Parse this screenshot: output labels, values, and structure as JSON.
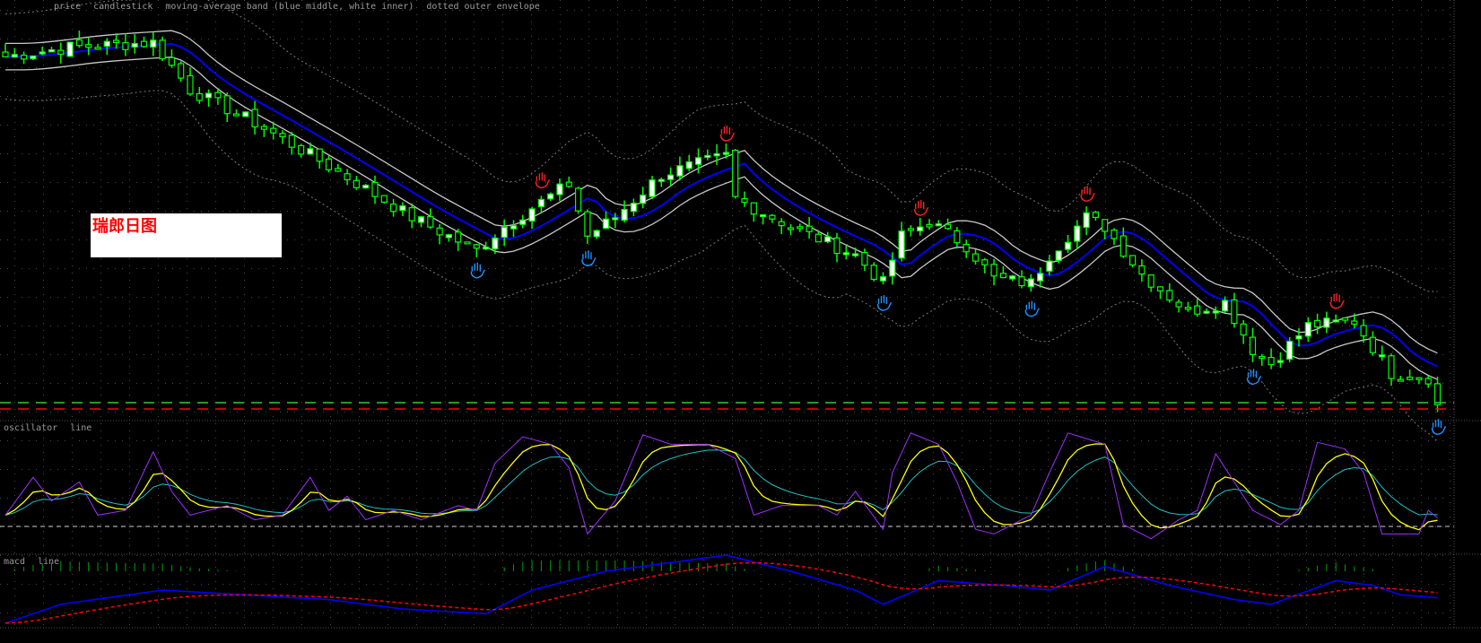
{
  "label": {
    "text": "瑞郎日图"
  },
  "colors": {
    "background": "#000000",
    "grid": "#5a5a5a",
    "candle": "#00ff00",
    "bull_body": "#ffffff",
    "band_mid": "#0000ff",
    "band_inner": "#c8c8c8",
    "band_outer": "#7a7a7a",
    "osc_fast": "#9b30ff",
    "osc_mid": "#ffff00",
    "osc_slow": "#20c0c0",
    "macd": "#0000ff",
    "signal": "#ff0000",
    "hist": "#00a000",
    "top_marker": "#ff2020",
    "bottom_marker": "#2090ff",
    "level_green": "#33cc33",
    "level_red": "#ff0000"
  },
  "chart_data": [
    {
      "type": "candlestick",
      "pane": "price",
      "bars": 156,
      "close_anchors": [
        [
          0,
          0.94
        ],
        [
          7,
          0.95
        ],
        [
          16,
          0.955
        ],
        [
          20,
          0.905
        ],
        [
          27,
          0.87
        ],
        [
          34,
          0.83
        ],
        [
          39,
          0.8
        ],
        [
          44,
          0.77
        ],
        [
          51,
          0.735
        ],
        [
          54,
          0.76
        ],
        [
          57,
          0.78
        ],
        [
          61,
          0.805
        ],
        [
          63,
          0.75
        ],
        [
          66,
          0.77
        ],
        [
          71,
          0.815
        ],
        [
          78,
          0.835
        ],
        [
          79,
          0.79
        ],
        [
          85,
          0.76
        ],
        [
          92,
          0.73
        ],
        [
          95,
          0.7
        ],
        [
          97,
          0.75
        ],
        [
          100,
          0.765
        ],
        [
          104,
          0.74
        ],
        [
          107,
          0.705
        ],
        [
          111,
          0.7
        ],
        [
          113,
          0.73
        ],
        [
          117,
          0.77
        ],
        [
          119,
          0.76
        ],
        [
          123,
          0.71
        ],
        [
          128,
          0.67
        ],
        [
          132,
          0.68
        ],
        [
          135,
          0.63
        ],
        [
          137,
          0.615
        ],
        [
          141,
          0.655
        ],
        [
          146,
          0.66
        ],
        [
          150,
          0.605
        ],
        [
          154,
          0.6
        ],
        [
          155,
          0.57
        ]
      ],
      "overlays": [
        "moving-average band (blue middle, white inner)",
        "dotted outer envelope"
      ],
      "levels": [
        0.573,
        0.567
      ],
      "markers": {
        "top": [
          58,
          78,
          99,
          117,
          144
        ],
        "bottom": [
          51,
          63,
          95,
          111,
          135,
          155
        ]
      }
    },
    {
      "type": "line",
      "pane": "oscillator",
      "fast_anchors": [
        [
          0,
          12
        ],
        [
          3,
          52
        ],
        [
          5,
          27
        ],
        [
          8,
          47
        ],
        [
          10,
          12
        ],
        [
          13,
          17
        ],
        [
          16,
          79
        ],
        [
          18,
          37
        ],
        [
          20,
          12
        ],
        [
          24,
          22
        ],
        [
          27,
          7
        ],
        [
          30,
          12
        ],
        [
          33,
          52
        ],
        [
          35,
          17
        ],
        [
          37,
          32
        ],
        [
          39,
          7
        ],
        [
          42,
          17
        ],
        [
          45,
          7
        ],
        [
          49,
          22
        ],
        [
          51,
          17
        ],
        [
          53,
          67
        ],
        [
          56,
          95
        ],
        [
          59,
          87
        ],
        [
          61,
          62
        ],
        [
          63,
          -8
        ],
        [
          66,
          27
        ],
        [
          69,
          97
        ],
        [
          72,
          87
        ],
        [
          76,
          87
        ],
        [
          79,
          72
        ],
        [
          81,
          12
        ],
        [
          84,
          22
        ],
        [
          88,
          22
        ],
        [
          90,
          12
        ],
        [
          92,
          37
        ],
        [
          95,
          -3
        ],
        [
          96,
          57
        ],
        [
          98,
          99
        ],
        [
          101,
          87
        ],
        [
          103,
          47
        ],
        [
          105,
          -3
        ],
        [
          107,
          -8
        ],
        [
          109,
          2
        ],
        [
          111,
          12
        ],
        [
          113,
          57
        ],
        [
          115,
          99
        ],
        [
          119,
          87
        ],
        [
          121,
          2
        ],
        [
          124,
          -13
        ],
        [
          127,
          7
        ],
        [
          129,
          17
        ],
        [
          131,
          77
        ],
        [
          133,
          47
        ],
        [
          135,
          17
        ],
        [
          138,
          2
        ],
        [
          140,
          17
        ],
        [
          142,
          89
        ],
        [
          145,
          82
        ],
        [
          147,
          57
        ],
        [
          149,
          -8
        ],
        [
          153,
          -8
        ],
        [
          154,
          17
        ],
        [
          155,
          9
        ]
      ],
      "zero_level": 0
    },
    {
      "type": "line",
      "pane": "macd",
      "macd_anchors": [
        [
          0,
          -55
        ],
        [
          6,
          -35
        ],
        [
          17,
          -20
        ],
        [
          26,
          -25
        ],
        [
          35,
          -30
        ],
        [
          43,
          -40
        ],
        [
          52,
          -45
        ],
        [
          57,
          -20
        ],
        [
          65,
          0
        ],
        [
          78,
          17
        ],
        [
          85,
          0
        ],
        [
          92,
          -20
        ],
        [
          95,
          -35
        ],
        [
          101,
          -10
        ],
        [
          108,
          -15
        ],
        [
          113,
          -20
        ],
        [
          119,
          5
        ],
        [
          126,
          -15
        ],
        [
          133,
          -30
        ],
        [
          137,
          -35
        ],
        [
          144,
          -10
        ],
        [
          148,
          -15
        ],
        [
          151,
          -25
        ],
        [
          155,
          -28
        ]
      ]
    }
  ]
}
